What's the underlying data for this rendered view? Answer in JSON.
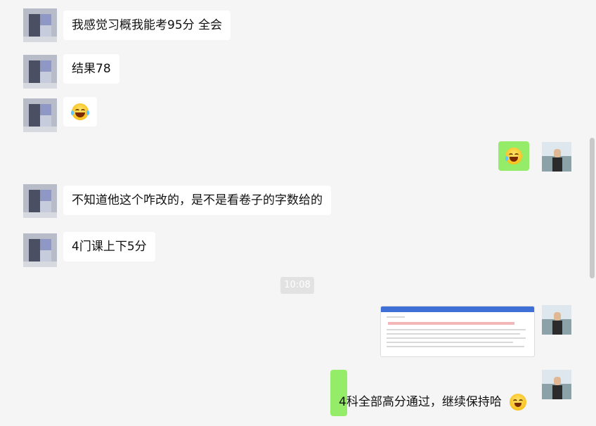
{
  "chat": {
    "messages": [
      {
        "side": "left",
        "text": "我感觉习概我能考95分 全会"
      },
      {
        "side": "left",
        "text": "结果78"
      },
      {
        "side": "left",
        "emoji": "laughing-tears-emoji"
      },
      {
        "side": "right",
        "emoji": "crying-laughing-emoji"
      },
      {
        "side": "left",
        "text": "不知道他这个咋改的，是不是看卷子的字数给的"
      },
      {
        "side": "left",
        "text": "4门课上下5分"
      },
      {
        "type": "timestamp",
        "text": "10:08"
      },
      {
        "side": "right",
        "image": "screenshot-thumbnail"
      },
      {
        "side": "right",
        "text": "4科全部高分通过，继续保持哈",
        "emoji": "cheeky-emoji"
      }
    ]
  },
  "colors": {
    "background": "#f5f5f5",
    "bubble_left": "#ffffff",
    "bubble_right": "#95ec69",
    "timestamp_bg": "#e2e2e2"
  }
}
